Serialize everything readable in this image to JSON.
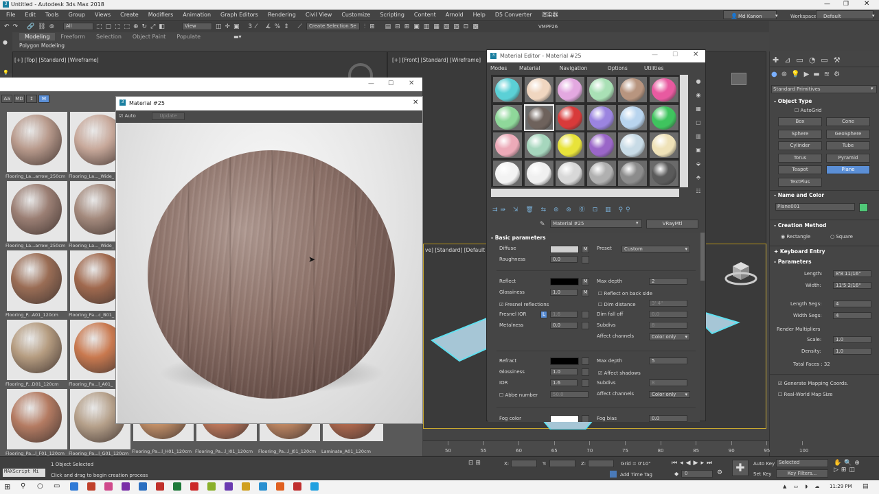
{
  "app": {
    "title": "Untitled - Autodesk 3ds Max 2018",
    "user": "Md Kanon",
    "workspaces_label": "Workspaces:",
    "workspace": "Default"
  },
  "menu": [
    "File",
    "Edit",
    "Tools",
    "Group",
    "Views",
    "Create",
    "Modifiers",
    "Animation",
    "Graph Editors",
    "Rendering",
    "Civil View",
    "Customize",
    "Scripting",
    "Content",
    "Arnold",
    "Help",
    "D5 Converter",
    "渲染器"
  ],
  "toolbar": {
    "selection_filter": "All",
    "ref_coord": "View",
    "create_selection_set": "Create Selection Se",
    "vmpp": "VMPP26"
  },
  "ribbon": {
    "tabs": [
      "Modeling",
      "Freeform",
      "Selection",
      "Object Paint",
      "Populate"
    ],
    "active_tab": "Modeling",
    "sub": "Polygon Modeling"
  },
  "viewports": {
    "top": "[+] [Top] [Standard] [Wireframe]",
    "front": "[+] [Front] [Standard] [Wireframe]",
    "persp": "ve] [Standard] [Default Sh"
  },
  "browser": {
    "buttons": [
      "Aa",
      "MD",
      "↕",
      "M"
    ],
    "items": [
      {
        "label": "Flooring_La...arrow_250cm",
        "color": "#b89a8c"
      },
      {
        "label": "Flooring_La..._Wide_",
        "color": "#c7a89a"
      },
      {
        "label": "Flooring_La...arrow_250cm",
        "color": "#9b7f74"
      },
      {
        "label": "Flooring_La..._Wide_",
        "color": "#a48a7d"
      },
      {
        "label": "Flooring_P...A01_120cm",
        "color": "#9a6d55"
      },
      {
        "label": "Flooring_Pa...c_B01_",
        "color": "#a0694e"
      },
      {
        "label": "Flooring_P...D01_120cm",
        "color": "#b59c80"
      },
      {
        "label": "Flooring_Pa...l_A01_",
        "color": "#c9794f"
      },
      {
        "label": "Flooring_Pa...l_F01_120cm",
        "color": "#b47b62"
      },
      {
        "label": "Flooring_Pa...l_G01_120cm",
        "color": "#b5a08a"
      }
    ],
    "bottom_items": [
      {
        "label": "Flooring_Pa...l_H01_120cm",
        "color": "#c9946a"
      },
      {
        "label": "Flooring_Pa...l_I01_120cm",
        "color": "#c27a5c"
      },
      {
        "label": "Flooring_Pa...l_J01_120cm",
        "color": "#c48a64"
      },
      {
        "label": "Laminate_A01_120cm",
        "color": "#b36a4e"
      }
    ]
  },
  "material_window": {
    "title": "Material #25",
    "auto_label": "Auto",
    "update_label": "Update"
  },
  "editor": {
    "title": "Material Editor - Material #25",
    "menu": [
      "Modes",
      "Material",
      "Navigation",
      "Options",
      "Utilities"
    ],
    "slots": [
      "#5bd0d6",
      "#f0d6c0",
      "#e3a8e0",
      "#a9e0b5",
      "#b8957f",
      "#e85aa0",
      "#8fd89a",
      "#6e625c",
      "#d83a3a",
      "#9b84e0",
      "#b8d4ee",
      "#3fc45e",
      "#ecaab8",
      "#a6d6bd",
      "#e8e33a",
      "#9a66c8",
      "#c8dbe6",
      "#efe2b8",
      "#f3f3f3",
      "#f0f0f0",
      "#d8d8d8",
      "#b0b0b0",
      "#8c8c8c",
      "#5a5a5a"
    ],
    "material_name": "Material #25",
    "material_type": "VRayMtl",
    "rollout": "Basic parameters",
    "diffuse": "Diffuse",
    "roughness": "Roughness",
    "roughness_val": "0.0",
    "preset": "Preset",
    "preset_val": "Custom",
    "reflect": "Reflect",
    "glossiness": "Glossiness",
    "glossiness_val": "1.0",
    "max_depth": "Max depth",
    "max_depth_val": "2",
    "reflect_back": "Reflect on back side",
    "fresnel": "Fresnel reflections",
    "dim_distance": "Dim distance",
    "dim_distance_val": "3' 4\"",
    "fresnel_ior": "Fresnel IOR",
    "fresnel_ior_val": "1.6",
    "dim_falloff": "Dim fall off",
    "dim_falloff_val": "0.0",
    "metalness": "Metalness",
    "metalness_val": "0.0",
    "subdivs": "Subdivs",
    "subdivs_val": "8",
    "affect_channels": "Affect channels",
    "affect_val": "Color only",
    "refract": "Refract",
    "refr_gloss_val": "1.0",
    "refr_max_depth_val": "5",
    "affect_shadows": "Affect shadows",
    "ior": "IOR",
    "ior_val": "1.6",
    "abbe": "Abbe number",
    "abbe_val": "50.0",
    "fog_color": "Fog color",
    "fog_bias": "Fog bias",
    "fog_bias_val": "0.0",
    "m_label": "M",
    "l_label": "L"
  },
  "command_panel": {
    "dropdown": "Standard Primitives",
    "object_type": "Object Type",
    "autogrid": "AutoGrid",
    "buttons": [
      "Box",
      "Cone",
      "Sphere",
      "GeoSphere",
      "Cylinder",
      "Tube",
      "Torus",
      "Pyramid",
      "Teapot",
      "Plane",
      "TextPlus"
    ],
    "active_button": "Plane",
    "name_and_color": "Name and Color",
    "object_name": "Plane001",
    "object_color": "#50c878",
    "creation_method": "Creation Method",
    "rectangle": "Rectangle",
    "square": "Square",
    "keyboard_entry": "Keyboard Entry",
    "parameters": "Parameters",
    "length_label": "Length:",
    "length_val": "8'8 11/16\"",
    "width_label": "Width:",
    "width_val": "11'5 2/16\"",
    "length_segs_label": "Length Segs:",
    "length_segs_val": "4",
    "width_segs_label": "Width Segs:",
    "width_segs_val": "4",
    "render_multipliers": "Render Multipliers",
    "scale_label": "Scale:",
    "scale_val": "1.0",
    "density_label": "Density:",
    "density_val": "1.0",
    "total_faces": "Total Faces : 32",
    "gen_mapping": "Generate Mapping Coords.",
    "real_world": "Real-World Map Size"
  },
  "timeline": {
    "ticks": [
      "50",
      "55",
      "60",
      "65",
      "70",
      "75",
      "80",
      "85",
      "90",
      "95",
      "100"
    ]
  },
  "status": {
    "maxscript": "MAXScript Mi",
    "selected": "1 Object Selected",
    "prompt": "Click and drag to begin creation process",
    "x_label": "X:",
    "y_label": "Y:",
    "z_label": "Z:",
    "grid": "Grid = 0'10\"",
    "add_time_tag": "Add Time Tag",
    "frame": "0",
    "auto_key": "Auto Key",
    "set_key": "Set Key",
    "selected_dd": "Selected",
    "key_filters": "Key Filters..."
  },
  "taskbar": {
    "time": "11:29 PM",
    "app_colors": [
      "#2f7ad6",
      "#c0402a",
      "#d04a8c",
      "#7a2fa8",
      "#2a6fc0",
      "#c0302a",
      "#1e7a3a",
      "#cc2a2a",
      "#8ab02a",
      "#6a3ab0",
      "#d0a020",
      "#2a90d0",
      "#e06020",
      "#c03030",
      "#20a0e0"
    ]
  }
}
